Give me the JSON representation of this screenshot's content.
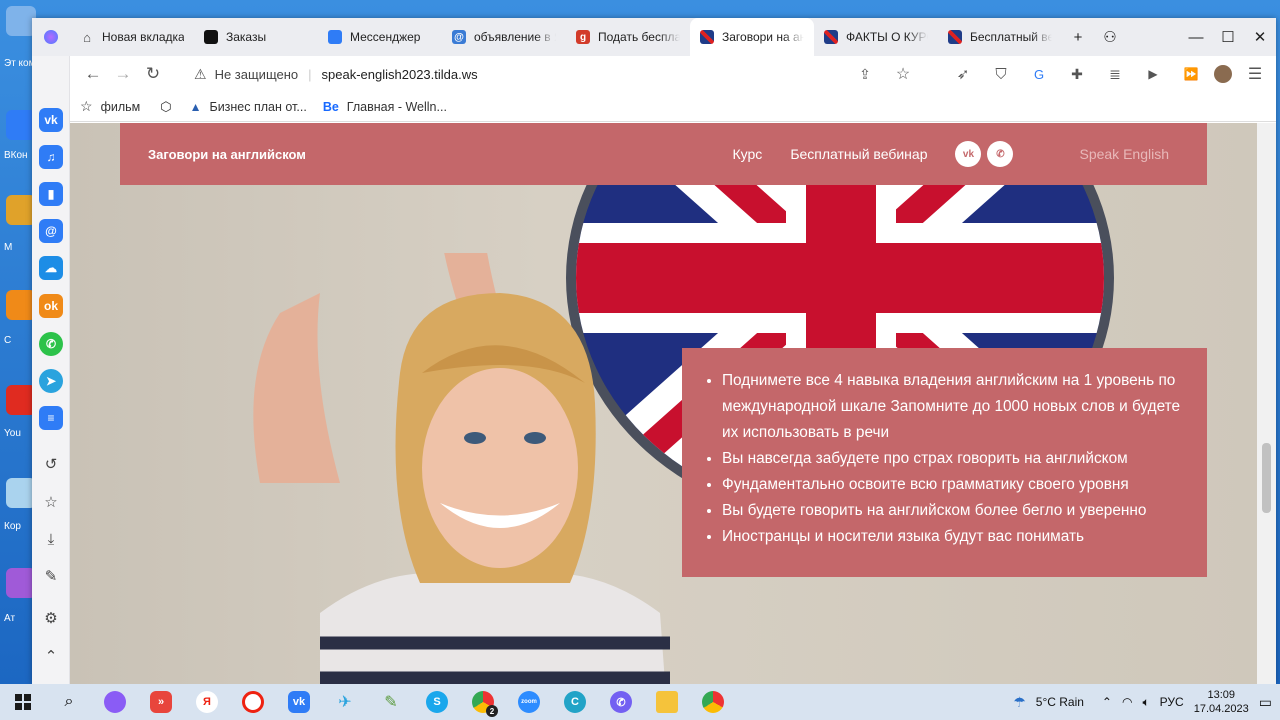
{
  "tabs": [
    {
      "label": "Новая вкладка",
      "color": "#ffffff",
      "glyph": "⌂"
    },
    {
      "label": "Заказы",
      "color": "#111111",
      "glyph": ""
    },
    {
      "label": "Мессенджер",
      "color": "#2f7cf6",
      "glyph": ""
    },
    {
      "label": "объявление в Ян",
      "color": "#3a7bd5",
      "glyph": "@"
    },
    {
      "label": "Подать бесплатн",
      "color": "#d23b2a",
      "glyph": "g"
    },
    {
      "label": "Заговори на англ",
      "color": "#1f3c88",
      "glyph": ""
    },
    {
      "label": "ФАКТЫ О КУРСЕ",
      "color": "#1f3c88",
      "glyph": ""
    },
    {
      "label": "Бесплатный веб",
      "color": "#1f3c88",
      "glyph": ""
    }
  ],
  "address": {
    "security": "Не защищено",
    "url": "speak-english2023.tilda.ws"
  },
  "bookmarks": [
    {
      "label": "фильм"
    },
    {
      "label": ""
    },
    {
      "label": "Бизнес план от..."
    },
    {
      "label": "Главная - Welln..."
    }
  ],
  "site": {
    "brand": "Заговори на английском",
    "menu": [
      "Курс",
      "Бесплатный вебинар"
    ],
    "speak": "Speak English",
    "benefits": [
      "Поднимете все 4 навыка владения английским на 1 уровень по международной шкале Запомните до 1000 новых слов и будете их использовать в речи",
      "Вы навсегда забудете про страх говорить на английском",
      "Фундаментально освоите всю грамматику своего уровня",
      "Вы будете говорить на английском более бегло и уверенно",
      "Иностранцы и носители языка будут вас понимать"
    ],
    "accent": "#c4676a"
  },
  "taskbar": {
    "weather": "5°C  Rain",
    "lang": "РУС",
    "time": "13:09",
    "date": "17.04.2023",
    "badge": "2"
  },
  "desktop_labels": [
    "Эт комп",
    "ВКон",
    "М",
    "С",
    "You",
    "Кор",
    "Ат"
  ]
}
